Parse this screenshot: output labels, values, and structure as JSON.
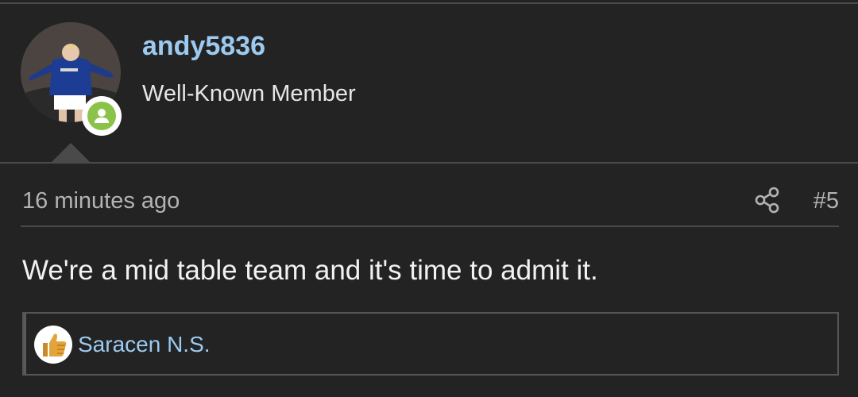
{
  "post": {
    "author": {
      "username": "andy5836",
      "title": "Well-Known Member",
      "avatar_icon": "user-avatar-photo",
      "status_icon": "online-user-icon",
      "status_color": "#8bc34a"
    },
    "meta": {
      "time": "16 minutes ago",
      "number": "#5",
      "share_icon": "share-icon"
    },
    "body": "We're a mid table team and it's time to admit it.",
    "reactions": {
      "icon": "thumbs-up-icon",
      "users": "Saracen N.S."
    }
  },
  "colors": {
    "background": "#232323",
    "link": "#9ccaf0",
    "text": "#f2f2f2",
    "muted": "#b3b3b3",
    "border": "#4a4a4a"
  }
}
